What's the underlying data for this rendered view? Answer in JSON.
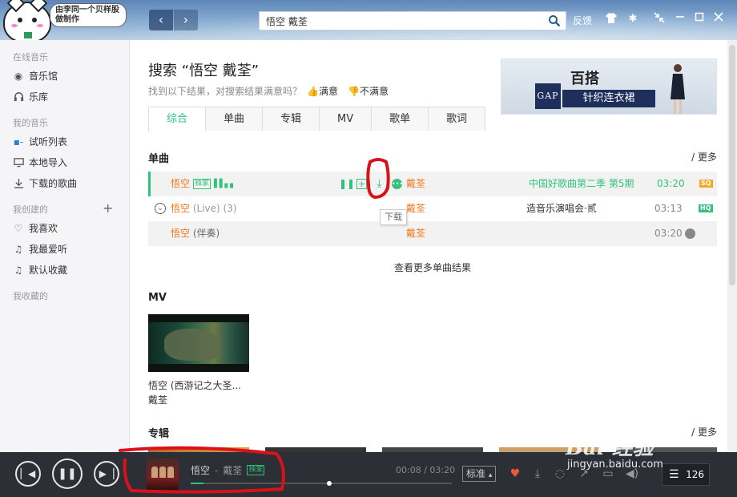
{
  "header": {
    "speech_text": "由李同一个贝样股\n做制作",
    "search_value": "悟空 戴荃",
    "feedback": "反馈"
  },
  "sidebar": {
    "online_section": "在线音乐",
    "music_hall": "音乐馆",
    "library": "乐库",
    "my_music_section": "我的音乐",
    "trial_list": "试听列表",
    "local_import": "本地导入",
    "downloaded": "下载的歌曲",
    "created_section": "我创建的",
    "like": "我喜欢",
    "favorite_listen": "我最爱听",
    "default_collection": "默认收藏",
    "collected_section": "我收藏的"
  },
  "search": {
    "title": "搜索 “悟空 戴荃”",
    "subtitle": "找到以下结果，对搜索结果满意吗？",
    "satisfied": "满意",
    "unsatisfied": "不满意"
  },
  "ad": {
    "brand": "GAP",
    "headline": "百搭",
    "tagline": "针织连衣裙"
  },
  "tabs": [
    "综合",
    "单曲",
    "专辑",
    "MV",
    "歌单",
    "歌词"
  ],
  "songs_section": {
    "title": "单曲",
    "more": "/ 更多",
    "rows": [
      {
        "name": "悟空",
        "extra": "",
        "badge": "独家",
        "artist": "戴荃",
        "album": "中国好歌曲第二季 第5期",
        "duration": "03:20",
        "quality": "SQ"
      },
      {
        "name": "悟空",
        "extra": "(Live) (3)",
        "badge": "",
        "artist": "戴荃",
        "album": "造音乐演唱会·贰",
        "duration": "03:13",
        "quality": "HQ"
      },
      {
        "name": "悟空",
        "extra": "(伴奏)",
        "badge": "",
        "artist": "戴荃",
        "album": "",
        "duration": "03:20",
        "quality": ""
      }
    ],
    "tooltip": "下载",
    "view_more": "查看更多单曲结果"
  },
  "mv_section": {
    "title": "MV",
    "mv_title": "悟空 (西游记之大圣...",
    "mv_artist": "戴荃"
  },
  "album_section": {
    "title": "专辑",
    "more": "/ 更多"
  },
  "player": {
    "title": "悟空",
    "separator": "-",
    "artist": "戴荃",
    "badge": "独家",
    "time": "00:08 / 03:20",
    "progress": 0.05,
    "quality": "标准",
    "playlist_count": "126"
  },
  "watermark": {
    "line1": "Bai 经验",
    "line2": "jingyan.baidu.com"
  },
  "colors": {
    "accent": "#31c27c",
    "song_orange": "#f07a1c",
    "player_bg": "#2c3036",
    "annotation_red": "#d8121a"
  }
}
